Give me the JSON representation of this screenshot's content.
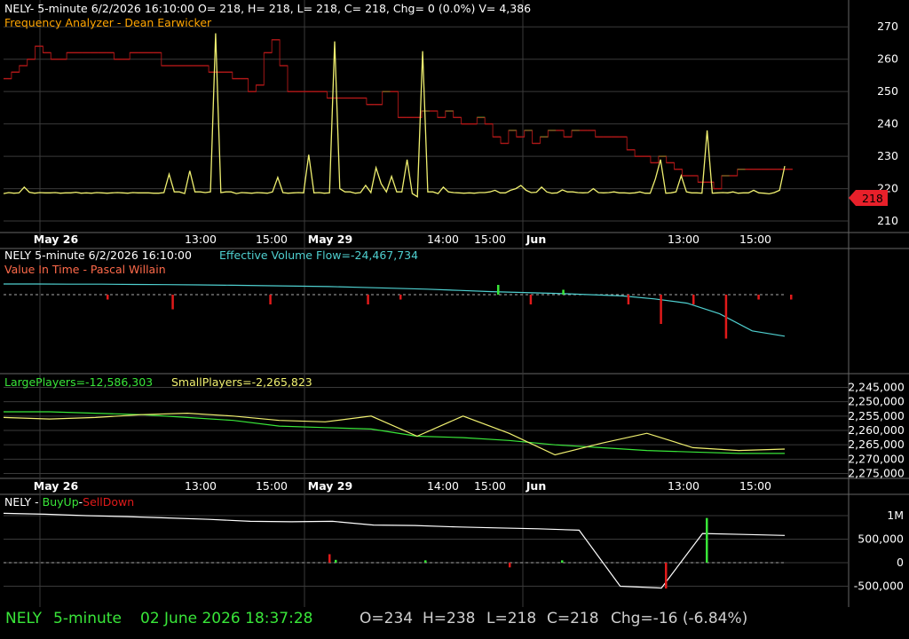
{
  "colors": {
    "background": "#000000",
    "grid": "#3a3a3a",
    "text": "#ffffff",
    "orange": "#ffa500",
    "cyan": "#4fd0d0",
    "salmon": "#ff6a4a",
    "green": "#39e639",
    "yellow": "#f0f070",
    "red": "#e01a1a",
    "dark_red": "#b01818",
    "price_tag": "#e8202a"
  },
  "panel1": {
    "header": "NELY- 5-minute 6/2/2026 16:10:00 O= 218, H= 218, L= 218, C= 218, Chg= 0 (0.0%) V= 4,386",
    "study": "Frequency Analyzer - Dean Earwicker",
    "y_ticks": [
      "270",
      "260",
      "250",
      "240",
      "230",
      "220",
      "210"
    ],
    "last_price_tag": "218"
  },
  "time_axis": {
    "labels": [
      "May 26",
      "13:00",
      "15:00",
      "May 29",
      "14:00",
      "15:00",
      "Jun",
      "13:00",
      "15:00"
    ],
    "bold": [
      true,
      false,
      false,
      true,
      false,
      false,
      true,
      false,
      false
    ]
  },
  "panel2": {
    "header": "NELY 5-minute  6/2/2026 16:10:00",
    "flow_label": "Effective Volume Flow=-24,467,734",
    "study": "Value In Time - Pascal Willain"
  },
  "panel3": {
    "large_label": "LargePlayers=-12,586,303",
    "small_label": "SmallPlayers=-2,265,823",
    "y_ticks": [
      "2,245,000",
      "2,250,000",
      "2,255,000",
      "2,260,000",
      "2,265,000",
      "2,270,000",
      "2,275,000"
    ]
  },
  "panel4": {
    "prefix": "NELY - ",
    "buy_label": "BuyUp",
    "sep": "-",
    "sell_label": "SellDown",
    "y_ticks": [
      "1M",
      "500,000",
      "0",
      "-500,000"
    ]
  },
  "status": {
    "symbol": "NELY",
    "interval": "5-minute",
    "datetime": "02 June 2026 18:37:28",
    "open": "O=234",
    "high": "H=238",
    "low": "L=218",
    "close": "C=218",
    "change": "Chg=-16 (-6.84%)"
  },
  "chart_data": [
    {
      "type": "line",
      "title": "Frequency Analyzer - Dean Earwicker",
      "ylim": [
        207,
        275
      ],
      "x_count": 100,
      "series": [
        {
          "name": "NELY",
          "style": "step",
          "values": [
            254,
            256,
            258,
            260,
            264,
            262,
            260,
            260,
            262,
            262,
            262,
            262,
            262,
            262,
            260,
            260,
            262,
            262,
            262,
            262,
            258,
            258,
            258,
            258,
            258,
            258,
            256,
            256,
            256,
            254,
            254,
            250,
            252,
            262,
            266,
            258,
            250,
            250,
            250,
            250,
            250,
            248,
            248,
            248,
            248,
            248,
            246,
            246,
            250,
            250,
            242,
            242,
            242,
            244,
            244,
            242,
            244,
            242,
            240,
            240,
            242,
            240,
            236,
            234,
            238,
            236,
            238,
            234,
            236,
            238,
            238,
            236,
            238,
            238,
            238,
            236,
            236,
            236,
            236,
            232,
            230,
            230,
            228,
            230,
            228,
            226,
            224,
            224,
            222,
            222,
            220,
            224,
            224,
            226,
            226,
            226,
            226,
            226,
            226,
            226
          ]
        },
        {
          "name": "Frequency",
          "values": [
            218.5,
            218.8,
            218.6,
            218.7,
            220.5,
            218.9,
            218.6,
            218.8,
            218.7,
            218.7,
            218.8,
            218.6,
            218.7,
            218.7,
            218.9,
            218.6,
            218.7,
            218.6,
            218.8,
            218.7,
            218.6,
            218.7,
            218.8,
            218.7,
            218.6,
            218.8,
            218.7,
            218.7,
            218.7,
            218.6,
            218.6,
            218.8,
            224.5,
            219.0,
            219.0,
            218.5,
            225.5,
            219.0,
            219.0,
            218.8,
            219.0,
            268,
            218.8,
            219.0,
            219.0,
            218.5,
            218.8,
            218.7,
            218.6,
            218.8,
            218.7,
            218.6,
            219.0,
            223.5,
            218.8,
            218.6,
            218.7,
            218.8,
            218.7,
            230.5,
            218.7,
            218.8,
            218.6,
            218.7,
            265.5,
            220.0,
            219.0,
            219.0,
            218.6,
            218.8,
            221.0,
            218.8,
            226.5,
            221.5,
            219.0,
            223.8,
            219.0,
            219.0,
            229.0,
            218.5,
            217.5,
            262.5,
            219.0,
            219.0,
            218.5,
            220.5,
            219.0,
            218.8,
            218.7,
            218.6,
            218.7,
            218.6,
            218.8,
            218.8,
            219.0,
            219.5,
            218.7,
            218.7,
            219.5,
            220,
            221,
            219.5,
            218.8,
            218.9,
            220.5,
            219,
            218.6,
            218.7,
            219.6,
            219.0,
            219,
            218.8,
            218.7,
            218.8,
            220,
            218.8,
            218.7,
            218.8,
            219,
            218.7,
            218.7,
            218.6,
            218.7,
            219,
            218.6,
            218.6,
            223,
            229,
            218.6,
            218.7,
            219,
            224,
            219,
            218.7,
            218.7,
            218.6,
            238,
            218.6,
            218.7,
            218.8,
            218.7,
            219,
            218.6,
            218.7,
            218.7,
            219.5,
            218.7,
            218.6,
            218.4,
            218.8,
            219.5,
            227
          ]
        }
      ]
    },
    {
      "type": "line",
      "title": "Value In Time - Pascal Willain",
      "series": [
        {
          "name": "Effective Volume Flow",
          "values": [
            0.0,
            0.0,
            -0.1,
            -0.1,
            -0.2,
            -0.3,
            -0.4,
            -0.6,
            -0.8,
            -1.0,
            -1.2,
            -1.6,
            -2.0,
            -2.4,
            -3.0,
            -3.6,
            -4.0,
            -4.4,
            -5.0,
            -5.6,
            -7.0,
            -9.0,
            -14.0,
            -22.0,
            -24.5
          ]
        },
        {
          "name": "Volume bars",
          "values": [
            0,
            0,
            0,
            -1,
            0,
            -3,
            0,
            0,
            -2,
            0,
            0,
            -2,
            -1,
            0,
            0,
            2,
            -2,
            1,
            0,
            -2,
            -6,
            -2,
            -9,
            -1,
            -1
          ]
        }
      ]
    },
    {
      "type": "line",
      "ylim": [
        2277000,
        2243000
      ],
      "series": [
        {
          "name": "LargePlayers",
          "values": [
            2253500,
            2253500,
            2254000,
            2254500,
            2255500,
            2256500,
            2258500,
            2259000,
            2259500,
            2262000,
            2262500,
            2263500,
            2265000,
            2266000,
            2267000,
            2267500,
            2268000,
            2268000
          ]
        },
        {
          "name": "SmallPlayers",
          "values": [
            2255500,
            2256000,
            2255500,
            2254500,
            2254000,
            2255000,
            2256500,
            2257000,
            2255000,
            2262000,
            2255000,
            2261000,
            2268500,
            2264500,
            2261000,
            2266000,
            2267000,
            2266500
          ]
        }
      ]
    },
    {
      "type": "line",
      "ylim": [
        -620000,
        1130000
      ],
      "series": [
        {
          "name": "BuyUp-SellDown",
          "values": [
            1050000,
            1030000,
            1000000,
            980000,
            950000,
            920000,
            880000,
            870000,
            880000,
            800000,
            790000,
            760000,
            740000,
            720000,
            690000,
            -500000,
            -540000,
            620000,
            600000,
            580000
          ]
        }
      ]
    }
  ]
}
